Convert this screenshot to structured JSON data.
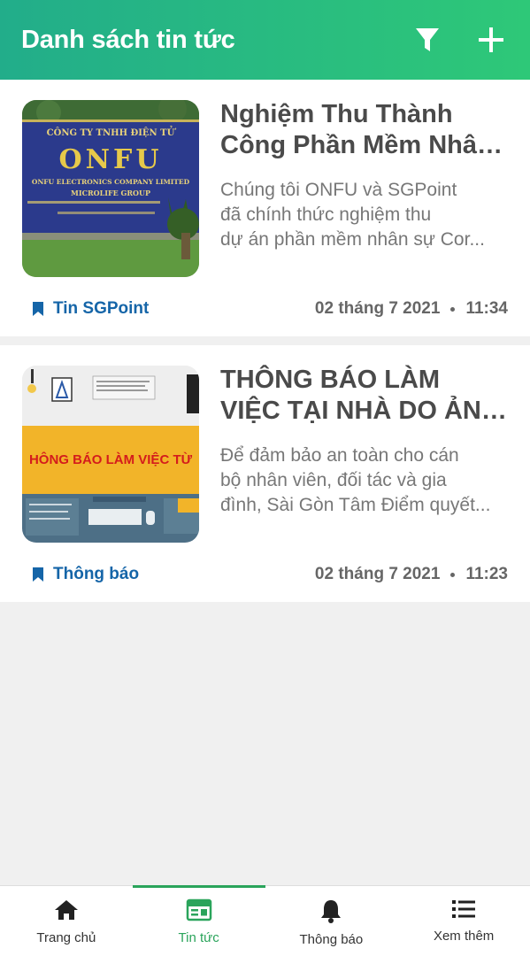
{
  "header": {
    "title": "Danh sách tin tức",
    "filter_icon": "filter-icon",
    "add_icon": "plus-icon"
  },
  "news": [
    {
      "title_line1": "Nghiệm Thu Thành",
      "title_line2": "Công Phần Mềm Nhân ...",
      "summary_line1": "Chúng tôi ONFU và SGPoint",
      "summary_line2": "đã chính thức nghiệm thu",
      "summary_line3": "dự án phần mềm nhân sự Cor...",
      "category": "Tin SGPoint",
      "date": "02 tháng 7 2021",
      "time": "11:34",
      "thumb": {
        "sign_line1": "CÔNG TY TNHH ĐIỆN TỬ",
        "sign_logo": "ONFU",
        "sign_line2": "ONFU ELECTRONICS COMPANY LIMITED",
        "sign_line3": "MICROLIFE GROUP"
      }
    },
    {
      "title_line1": "THÔNG BÁO LÀM",
      "title_line2": "VIỆC TẠI NHÀ DO ẢNH...",
      "summary_line1": "Để đảm bảo an toàn cho cán",
      "summary_line2": "bộ nhân viên, đối tác và gia",
      "summary_line3": "đình, Sài Gòn Tâm Điểm quyết...",
      "category": "Thông báo",
      "date": "02 tháng 7 2021",
      "time": "11:23",
      "thumb": {
        "banner": "HÔNG BÁO LÀM VIỆC TỪ"
      }
    }
  ],
  "nav": {
    "home": "Trang chủ",
    "news": "Tin tức",
    "notifications": "Thông báo",
    "more": "Xem thêm"
  },
  "colors": {
    "header_start": "#22ad8a",
    "header_end": "#2ec878",
    "category": "#1565a8",
    "active": "#2aa45b"
  }
}
